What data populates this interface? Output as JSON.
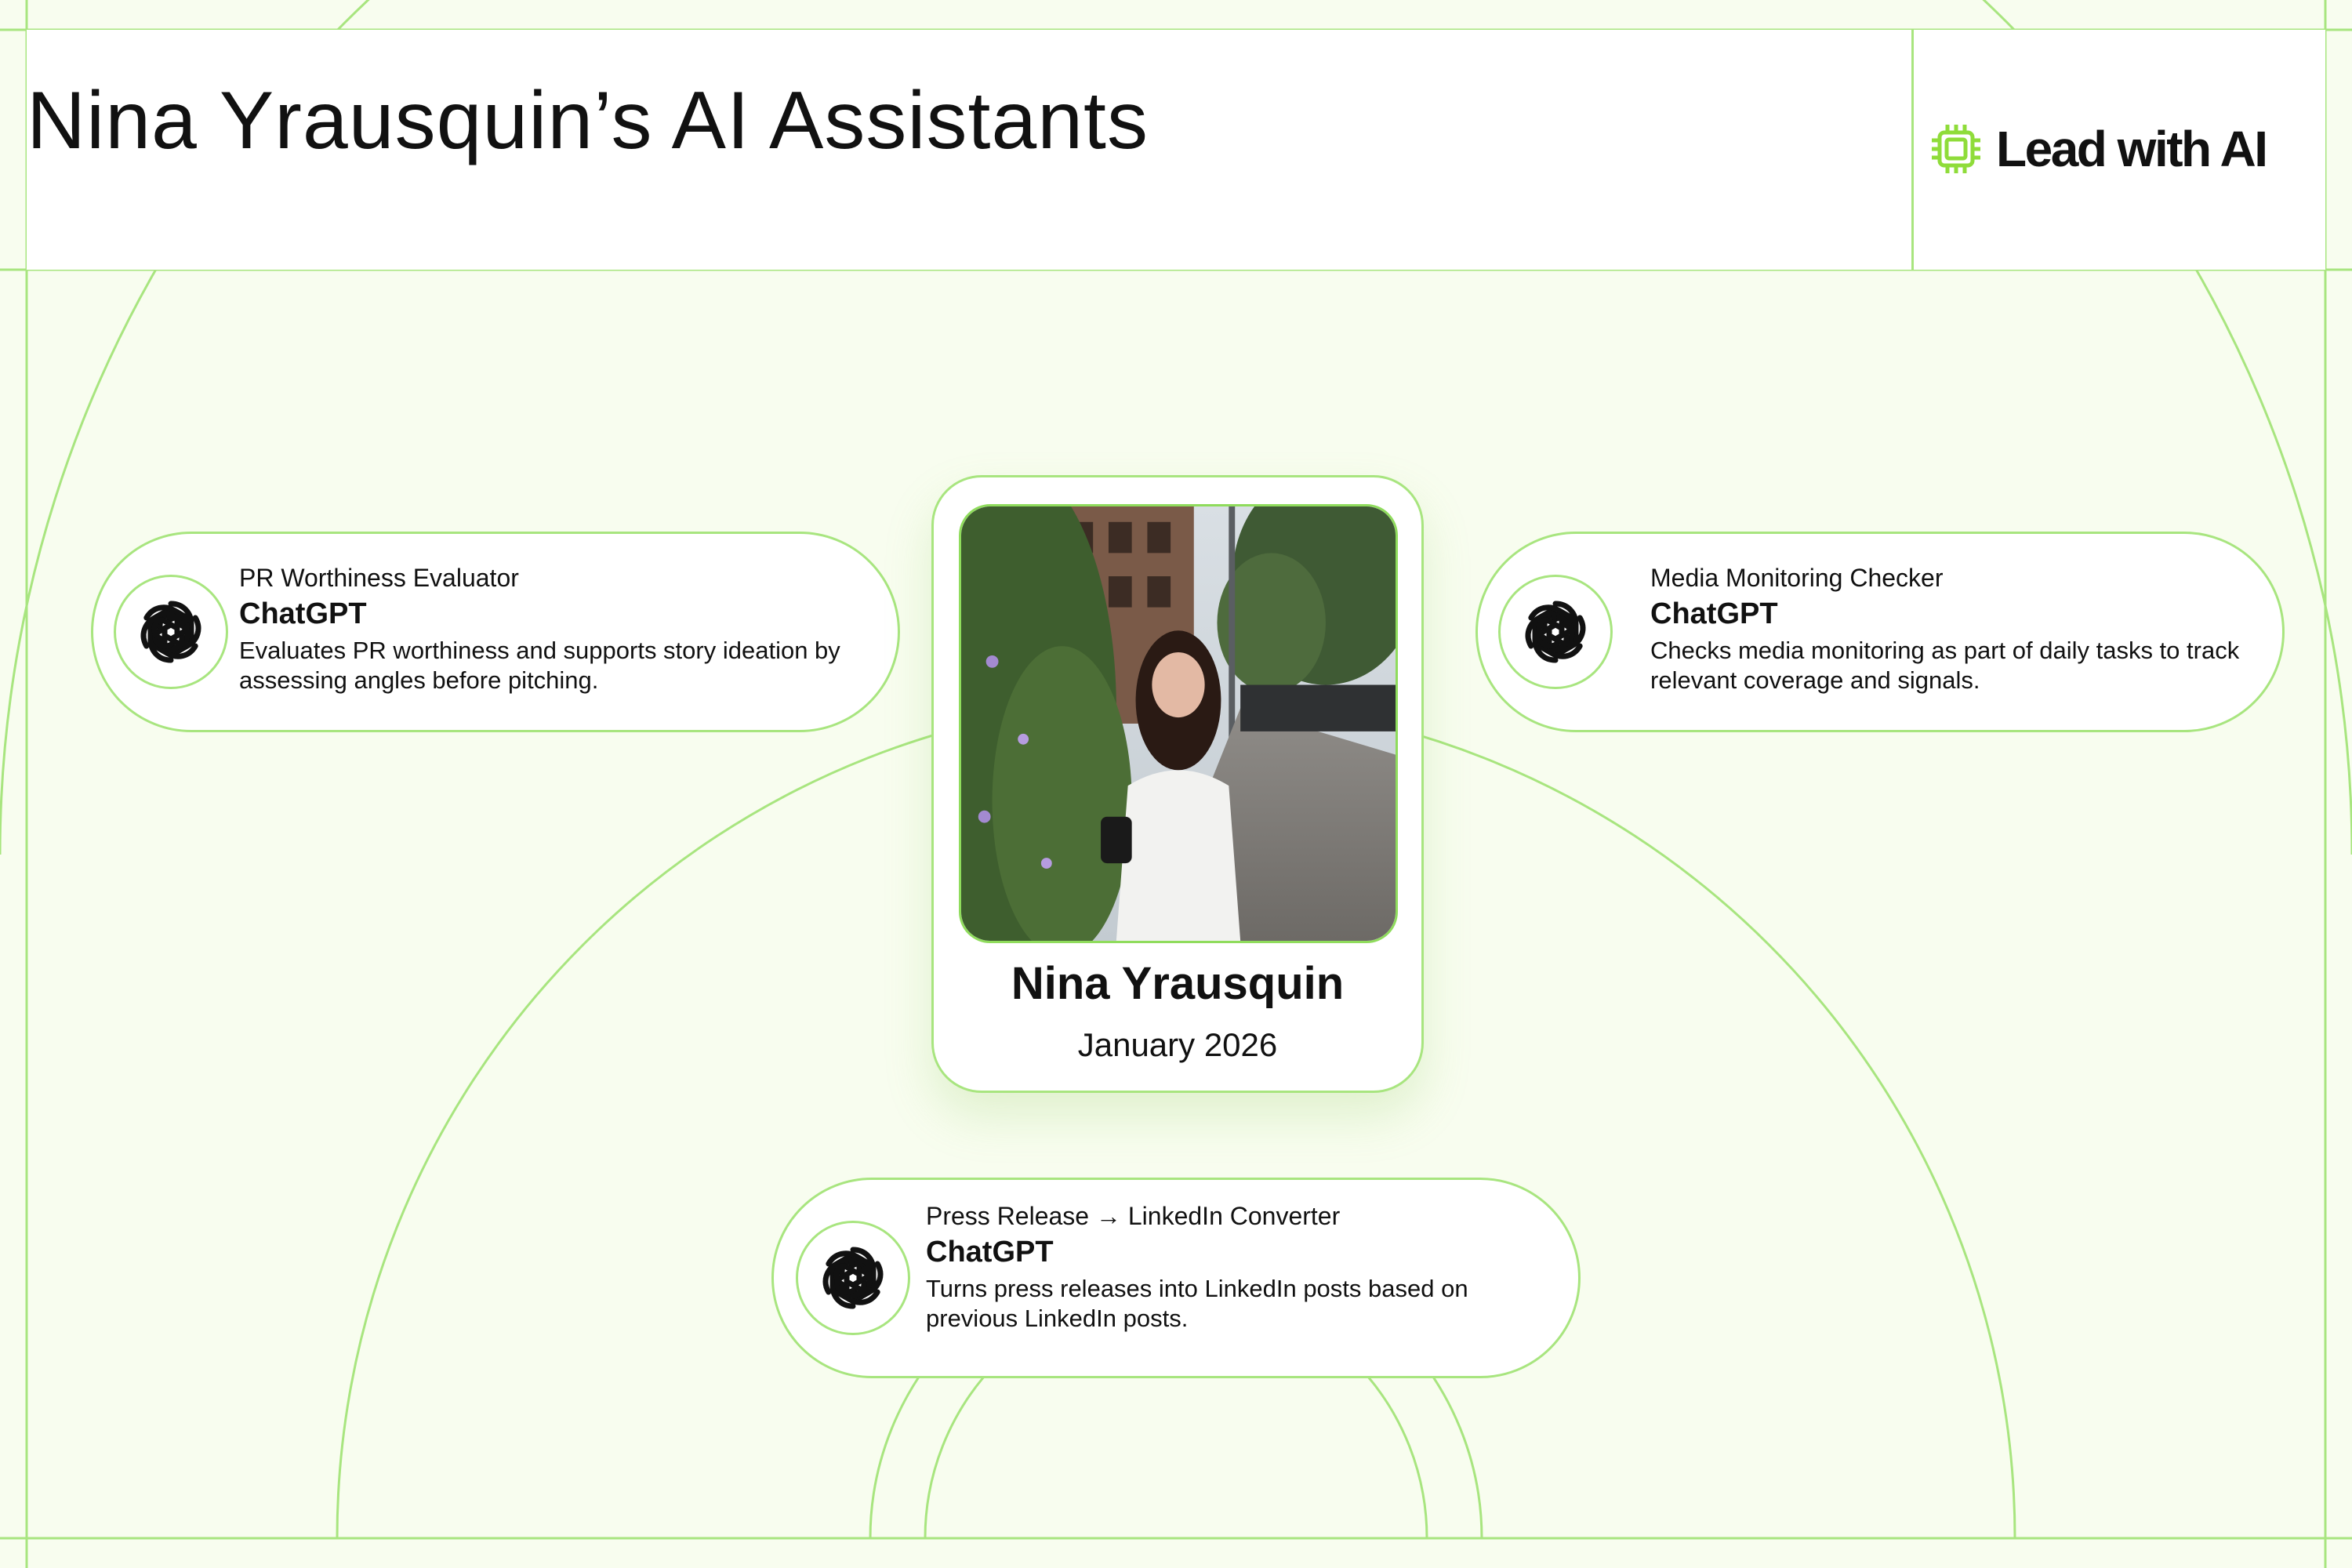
{
  "header": {
    "title": "Nina Yrausquin’s AI Assistants",
    "logo_text": "Lead with AI"
  },
  "profile": {
    "name": "Nina Yrausquin",
    "date": "January 2026"
  },
  "assistants": [
    {
      "name": "PR Worthiness Evaluator",
      "tool": "ChatGPT",
      "description": "Evaluates PR worthiness and supports story ideation by assessing angles before pitching.",
      "icon": "openai-icon"
    },
    {
      "name": "Media Monitoring Checker",
      "tool": "ChatGPT",
      "description": "Checks media monitoring as part of daily tasks to track relevant coverage and signals.",
      "icon": "openai-icon"
    },
    {
      "name": "Press Release → LinkedIn Converter",
      "tool": "ChatGPT",
      "description": "Turns press releases into LinkedIn posts based on previous LinkedIn posts.",
      "icon": "openai-icon"
    }
  ],
  "colors": {
    "background": "#f8fdef",
    "accent_line": "#a8e57f",
    "logo_green": "#8fdc3a",
    "text": "#111111"
  }
}
